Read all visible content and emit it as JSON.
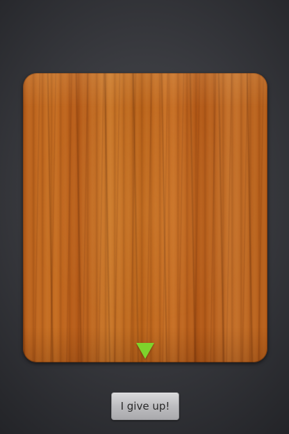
{
  "board": {
    "indicator_icon": "triangle-down-icon",
    "indicator_color": "#7ed42c"
  },
  "actions": {
    "give_up_label": "I give up!"
  }
}
